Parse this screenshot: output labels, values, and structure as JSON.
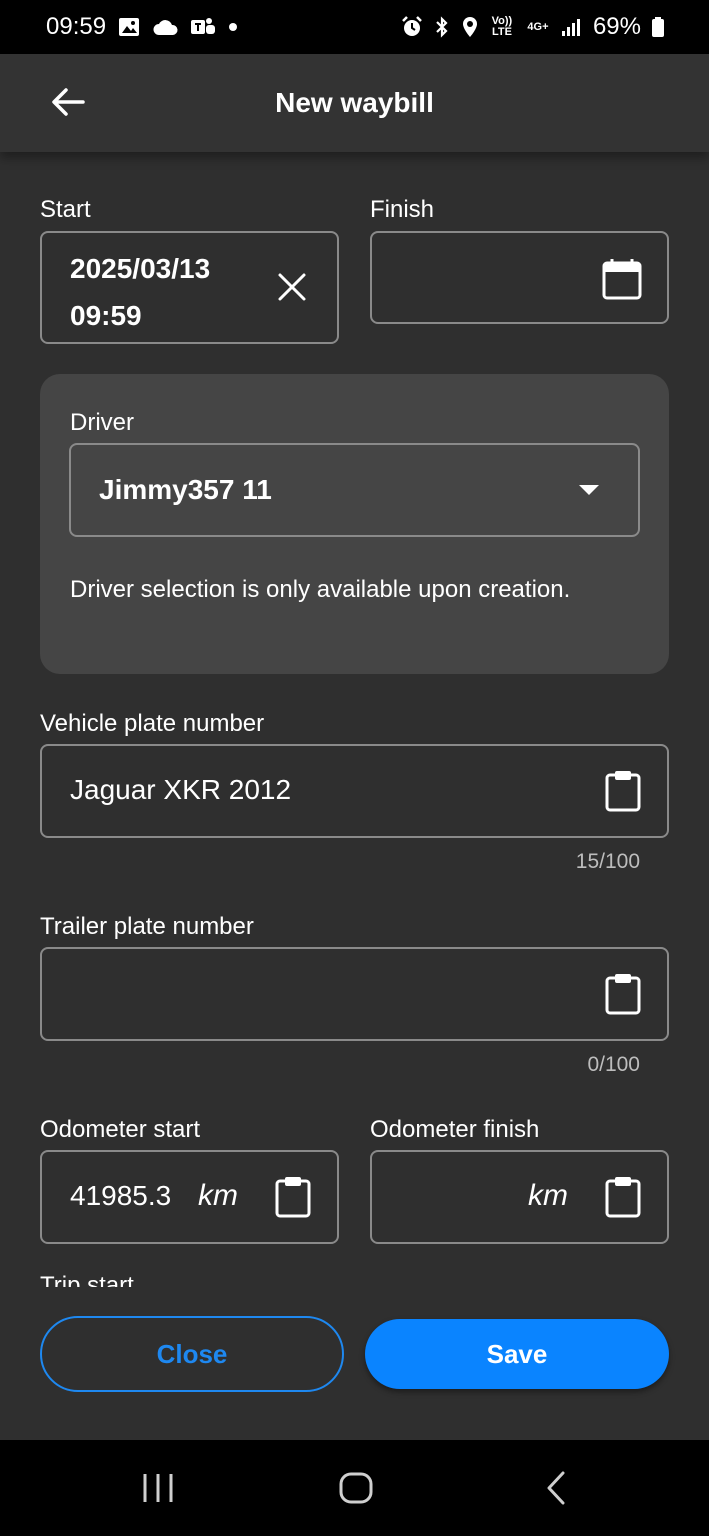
{
  "status_bar": {
    "time": "09:59",
    "battery": "69%",
    "volte_label": "Vo)) LTE",
    "network_label": "4G+",
    "left_icons": [
      "gallery-icon",
      "cloud-icon",
      "teams-icon",
      "dot-icon"
    ],
    "right_icons": [
      "alarm-icon",
      "bluetooth-icon",
      "location-icon",
      "volte-icon",
      "network-4g-icon",
      "signal-icon",
      "battery-icon"
    ]
  },
  "app_bar": {
    "title": "New waybill",
    "back_icon": "arrow-left-icon"
  },
  "form": {
    "start": {
      "label": "Start",
      "date": "2025/03/13",
      "time": "09:59",
      "clear_icon": "close-icon"
    },
    "finish": {
      "label": "Finish",
      "value": "",
      "icon": "calendar-icon"
    },
    "driver": {
      "label": "Driver",
      "value": "Jimmy357 11",
      "icon": "dropdown-arrow-icon",
      "note": "Driver selection is only available upon creation."
    },
    "vehicle_plate": {
      "label": "Vehicle plate number",
      "value": "Jaguar XKR 2012",
      "counter": "15/100",
      "icon": "clipboard-icon"
    },
    "trailer_plate": {
      "label": "Trailer plate number",
      "value": "",
      "counter": "0/100",
      "icon": "clipboard-icon"
    },
    "odometer_start": {
      "label": "Odometer start",
      "value": "41985.3",
      "unit": "km",
      "icon": "clipboard-icon"
    },
    "odometer_finish": {
      "label": "Odometer finish",
      "value": "",
      "unit": "km",
      "icon": "clipboard-icon"
    },
    "next_section_label_partial": "Trip start"
  },
  "actions": {
    "close_label": "Close",
    "save_label": "Save"
  },
  "nav_bar": {
    "icons": [
      "recent-apps-icon",
      "home-icon",
      "back-nav-icon"
    ]
  },
  "colors": {
    "background": "#2f2f2f",
    "card": "#454545",
    "accent": "#0a84ff",
    "border": "#8a8a8a"
  }
}
